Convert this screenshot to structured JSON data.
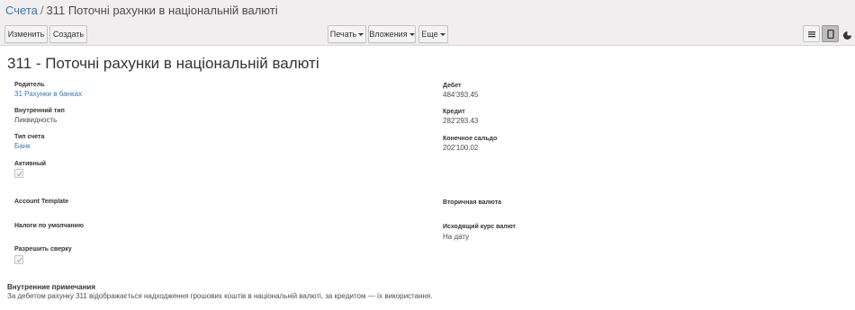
{
  "breadcrumb": {
    "parent": "Счета",
    "separator": "/",
    "current": "311 Поточні рахунки в національній валюті"
  },
  "toolbar": {
    "edit_label": "Изменить",
    "create_label": "Создать",
    "print_label": "Печать",
    "attachments_label": "Вложения",
    "more_label": "Еще"
  },
  "record": {
    "title": "311 - Поточні рахунки в національній валюті"
  },
  "left_fields": {
    "parent": {
      "label": "Родитель",
      "value": "31 Рахунки в банках"
    },
    "internal_type": {
      "label": "Внутренний тип",
      "value": "Ликвидность"
    },
    "account_type": {
      "label": "Тип счета",
      "value": "Банк"
    },
    "active": {
      "label": "Активный",
      "checked": true
    },
    "account_template": {
      "label": "Account Template",
      "value": ""
    },
    "default_taxes": {
      "label": "Налоги по умолчанию",
      "value": ""
    },
    "allow_reconcile": {
      "label": "Разрешить сверку",
      "checked": true
    }
  },
  "right_fields": {
    "debit": {
      "label": "Дебет",
      "value": "484'393.45"
    },
    "credit": {
      "label": "Кредит",
      "value": "282'293.43"
    },
    "balance": {
      "label": "Конечное сальдо",
      "value": "202'100.02"
    },
    "secondary_currency": {
      "label": "Вторичная валюта",
      "value": ""
    },
    "outgoing_rate": {
      "label": "Исходящий курс валют",
      "value": "На дату"
    }
  },
  "notes": {
    "label": "Внутренние примечания",
    "value": "За дебетом рахунку 311 відображається надходження грошових коштів в національній валюті, за кредитом — їх використання."
  },
  "colors": {
    "link": "#337ab7",
    "control_panel_bg": "#f0eeee",
    "text": "#4c4c4c"
  },
  "icons": {
    "list_view": "list-view-icon",
    "form_view": "form-view-icon",
    "other_view": "pie-chart-icon",
    "checkbox": "check-icon"
  }
}
